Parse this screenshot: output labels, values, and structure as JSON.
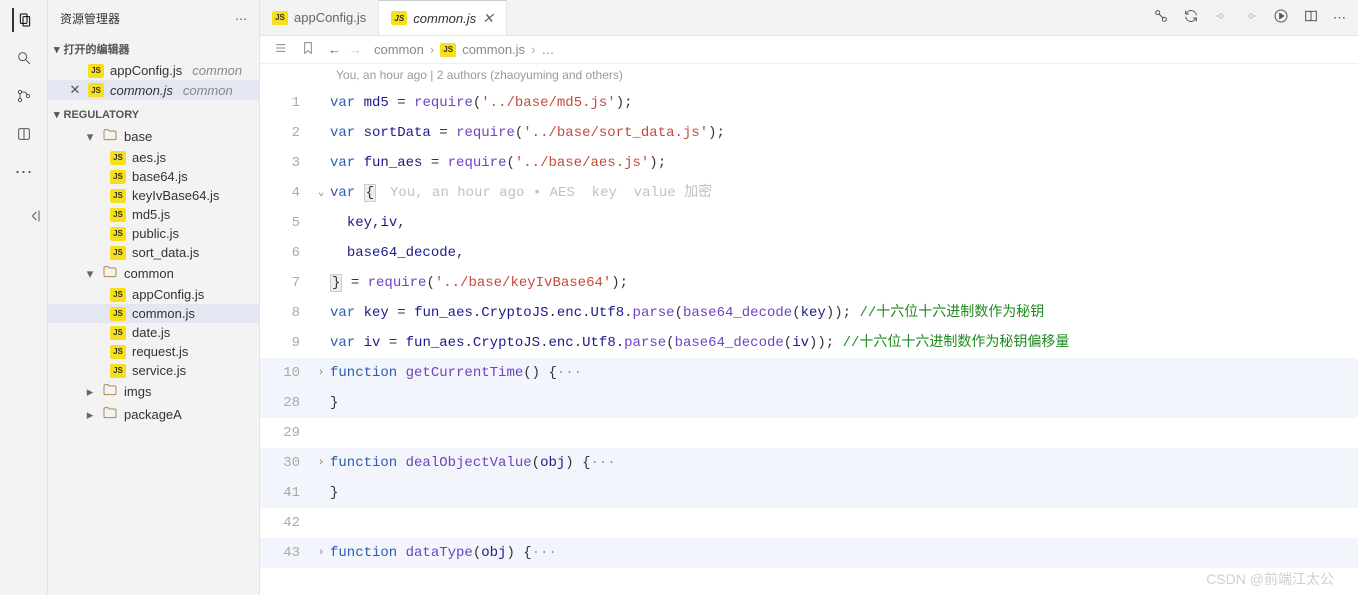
{
  "activitybar": {
    "icons": [
      "files",
      "search",
      "source-control",
      "extensions-alt"
    ]
  },
  "sidebar": {
    "title": "资源管理器",
    "open_editors_header": "打开的编辑器",
    "open_editors": [
      {
        "name": "appConfig.js",
        "folder": "common"
      },
      {
        "name": "common.js",
        "folder": "common",
        "active": true
      }
    ],
    "project_header": "REGULATORY",
    "tree": [
      {
        "type": "folder",
        "name": "base",
        "depth": 1,
        "expanded": true
      },
      {
        "type": "file",
        "name": "aes.js",
        "depth": 2
      },
      {
        "type": "file",
        "name": "base64.js",
        "depth": 2
      },
      {
        "type": "file",
        "name": "keyIvBase64.js",
        "depth": 2
      },
      {
        "type": "file",
        "name": "md5.js",
        "depth": 2
      },
      {
        "type": "file",
        "name": "public.js",
        "depth": 2
      },
      {
        "type": "file",
        "name": "sort_data.js",
        "depth": 2
      },
      {
        "type": "folder",
        "name": "common",
        "depth": 1,
        "expanded": true
      },
      {
        "type": "file",
        "name": "appConfig.js",
        "depth": 2
      },
      {
        "type": "file",
        "name": "common.js",
        "depth": 2,
        "selected": true
      },
      {
        "type": "file",
        "name": "date.js",
        "depth": 2
      },
      {
        "type": "file",
        "name": "request.js",
        "depth": 2
      },
      {
        "type": "file",
        "name": "service.js",
        "depth": 2
      },
      {
        "type": "folder",
        "name": "imgs",
        "depth": 1,
        "expanded": false
      },
      {
        "type": "folder",
        "name": "packageA",
        "depth": 1,
        "expanded": false
      }
    ]
  },
  "tabs": [
    {
      "name": "appConfig.js",
      "icon": "js",
      "active": false
    },
    {
      "name": "common.js",
      "icon": "js",
      "active": true,
      "closeable": true
    }
  ],
  "tab_actions": [
    "compare",
    "loop",
    "circle-open",
    "circle-open2",
    "run",
    "layout",
    "more"
  ],
  "breadcrumbs": {
    "parts": [
      "common",
      "common.js"
    ],
    "trailing": "…"
  },
  "gitlens": "You, an hour ago | 2 authors (zhaoyuming and others)",
  "inline_hint": "You, an hour ago • AES  key  value 加密",
  "code_lines": [
    {
      "num": 1,
      "tokens": [
        [
          "kw",
          "var"
        ],
        [
          "sp",
          " "
        ],
        [
          "var",
          "md5"
        ],
        [
          "sp",
          " "
        ],
        [
          "op",
          "="
        ],
        [
          "sp",
          " "
        ],
        [
          "call",
          "require"
        ],
        [
          "op",
          "("
        ],
        [
          "str",
          "'../base/md5.js'"
        ],
        [
          "op",
          ");"
        ]
      ]
    },
    {
      "num": 2,
      "tokens": [
        [
          "kw",
          "var"
        ],
        [
          "sp",
          " "
        ],
        [
          "var",
          "sortData"
        ],
        [
          "sp",
          " "
        ],
        [
          "op",
          "="
        ],
        [
          "sp",
          " "
        ],
        [
          "call",
          "require"
        ],
        [
          "op",
          "("
        ],
        [
          "str",
          "'../base/sort_data.js'"
        ],
        [
          "op",
          ");"
        ]
      ]
    },
    {
      "num": 3,
      "tokens": [
        [
          "kw",
          "var"
        ],
        [
          "sp",
          " "
        ],
        [
          "var",
          "fun_aes"
        ],
        [
          "sp",
          " "
        ],
        [
          "op",
          "="
        ],
        [
          "sp",
          " "
        ],
        [
          "call",
          "require"
        ],
        [
          "op",
          "("
        ],
        [
          "str",
          "'../base/aes.js'"
        ],
        [
          "op",
          ");"
        ]
      ]
    },
    {
      "num": 4,
      "fold": "down",
      "tokens": [
        [
          "kw",
          "var"
        ],
        [
          "sp",
          " "
        ],
        [
          "brace",
          "{"
        ]
      ],
      "hint": true
    },
    {
      "num": 5,
      "tokens": [
        [
          "sp",
          "  "
        ],
        [
          "var",
          "key"
        ],
        [
          "op",
          ","
        ],
        [
          "var",
          "iv"
        ],
        [
          "op",
          ","
        ]
      ]
    },
    {
      "num": 6,
      "tokens": [
        [
          "sp",
          "  "
        ],
        [
          "var",
          "base64_decode"
        ],
        [
          "op",
          ","
        ]
      ]
    },
    {
      "num": 7,
      "tokens": [
        [
          "brace",
          "}"
        ],
        [
          "sp",
          " "
        ],
        [
          "op",
          "="
        ],
        [
          "sp",
          " "
        ],
        [
          "call",
          "require"
        ],
        [
          "op",
          "("
        ],
        [
          "str",
          "'../base/keyIvBase64'"
        ],
        [
          "op",
          ");"
        ]
      ]
    },
    {
      "num": 8,
      "tokens": [
        [
          "kw",
          "var"
        ],
        [
          "sp",
          " "
        ],
        [
          "var",
          "key"
        ],
        [
          "sp",
          " "
        ],
        [
          "op",
          "="
        ],
        [
          "sp",
          " "
        ],
        [
          "var",
          "fun_aes"
        ],
        [
          "op",
          "."
        ],
        [
          "var",
          "CryptoJS"
        ],
        [
          "op",
          "."
        ],
        [
          "var",
          "enc"
        ],
        [
          "op",
          "."
        ],
        [
          "var",
          "Utf8"
        ],
        [
          "op",
          "."
        ],
        [
          "call",
          "parse"
        ],
        [
          "op",
          "("
        ],
        [
          "call",
          "base64_decode"
        ],
        [
          "op",
          "("
        ],
        [
          "var",
          "key"
        ],
        [
          "op",
          "));"
        ],
        [
          "sp",
          " "
        ],
        [
          "cmt",
          "//十六位十六进制数作为秘钥"
        ]
      ]
    },
    {
      "num": 9,
      "tokens": [
        [
          "kw",
          "var"
        ],
        [
          "sp",
          " "
        ],
        [
          "var",
          "iv"
        ],
        [
          "sp",
          " "
        ],
        [
          "op",
          "="
        ],
        [
          "sp",
          " "
        ],
        [
          "var",
          "fun_aes"
        ],
        [
          "op",
          "."
        ],
        [
          "var",
          "CryptoJS"
        ],
        [
          "op",
          "."
        ],
        [
          "var",
          "enc"
        ],
        [
          "op",
          "."
        ],
        [
          "var",
          "Utf8"
        ],
        [
          "op",
          "."
        ],
        [
          "call",
          "parse"
        ],
        [
          "op",
          "("
        ],
        [
          "call",
          "base64_decode"
        ],
        [
          "op",
          "("
        ],
        [
          "var",
          "iv"
        ],
        [
          "op",
          "));"
        ],
        [
          "sp",
          " "
        ],
        [
          "cmt",
          "//十六位十六进制数作为秘钥偏移量"
        ]
      ]
    },
    {
      "num": 10,
      "fold": "right",
      "hl": true,
      "tokens": [
        [
          "kw",
          "function"
        ],
        [
          "sp",
          " "
        ],
        [
          "fn",
          "getCurrentTime"
        ],
        [
          "op",
          "()"
        ],
        [
          "sp",
          " "
        ],
        [
          "op",
          "{"
        ],
        [
          "dots",
          "···"
        ]
      ]
    },
    {
      "num": 28,
      "hl": true,
      "tokens": [
        [
          "op",
          "}"
        ]
      ]
    },
    {
      "num": 29,
      "tokens": []
    },
    {
      "num": 30,
      "fold": "right",
      "hl": true,
      "tokens": [
        [
          "kw",
          "function"
        ],
        [
          "sp",
          " "
        ],
        [
          "fn",
          "dealObjectValue"
        ],
        [
          "op",
          "("
        ],
        [
          "param",
          "obj"
        ],
        [
          "op",
          ")"
        ],
        [
          "sp",
          " "
        ],
        [
          "op",
          "{"
        ],
        [
          "dots",
          "···"
        ]
      ]
    },
    {
      "num": 41,
      "hl": true,
      "tokens": [
        [
          "op",
          "}"
        ]
      ]
    },
    {
      "num": 42,
      "tokens": []
    },
    {
      "num": 43,
      "fold": "right",
      "hl": true,
      "tokens": [
        [
          "kw",
          "function"
        ],
        [
          "sp",
          " "
        ],
        [
          "fn",
          "dataType"
        ],
        [
          "op",
          "("
        ],
        [
          "param",
          "obj"
        ],
        [
          "op",
          ")"
        ],
        [
          "sp",
          " "
        ],
        [
          "op",
          "{"
        ],
        [
          "dots",
          "···"
        ]
      ]
    }
  ],
  "watermark": "CSDN @前端江太公"
}
